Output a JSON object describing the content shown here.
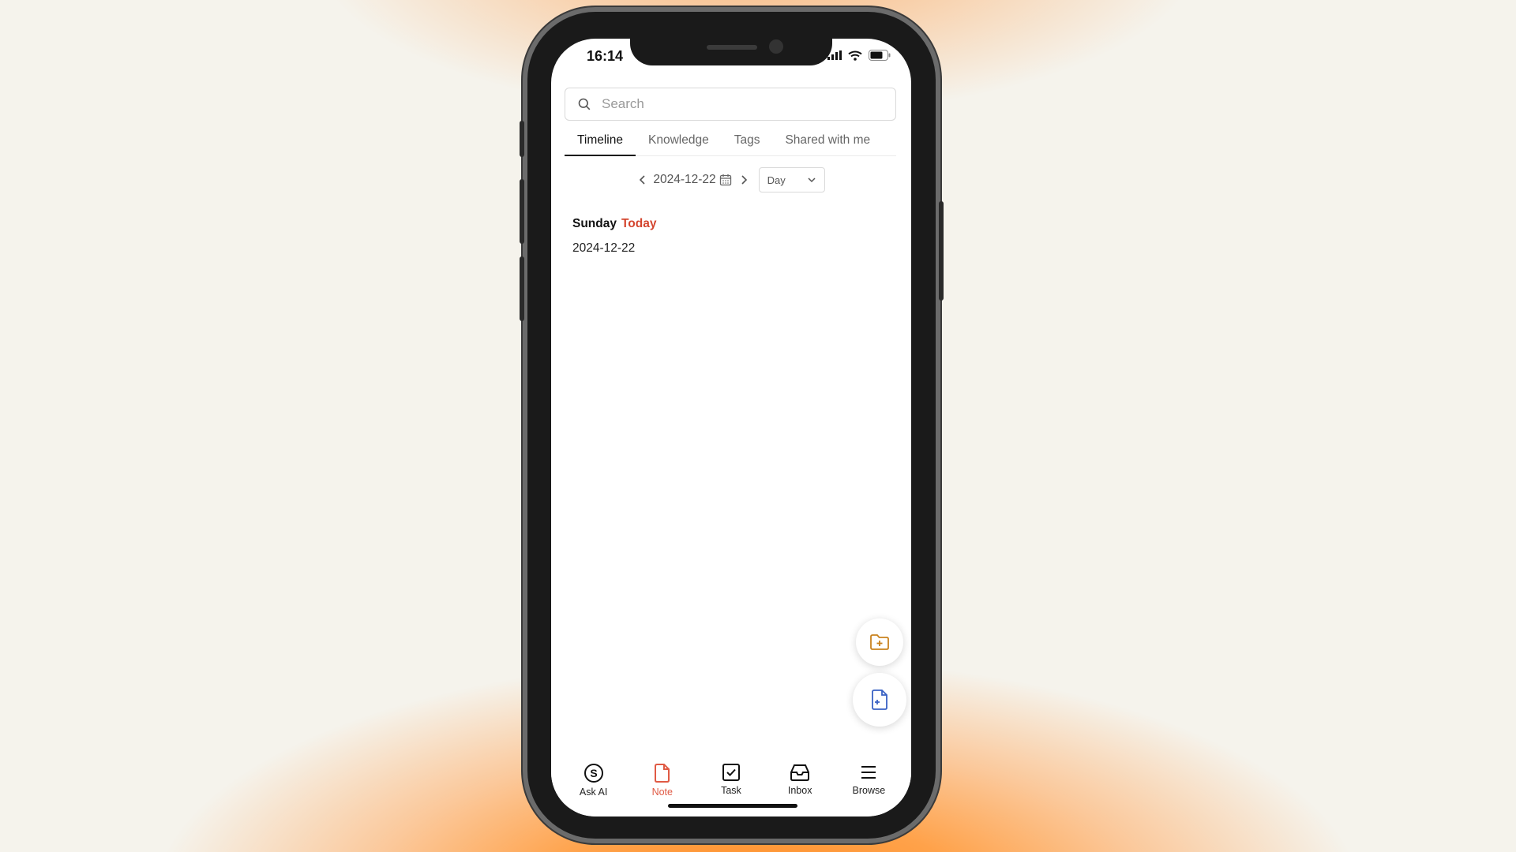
{
  "status_bar": {
    "time": "16:14"
  },
  "search": {
    "placeholder": "Search"
  },
  "tabs": [
    {
      "label": "Timeline",
      "active": true
    },
    {
      "label": "Knowledge",
      "active": false
    },
    {
      "label": "Tags",
      "active": false
    },
    {
      "label": "Shared with me",
      "active": false
    }
  ],
  "date_nav": {
    "date": "2024-12-22",
    "view_select": "Day"
  },
  "day": {
    "weekday": "Sunday",
    "today_label": "Today",
    "date": "2024-12-22"
  },
  "bottom_nav": [
    {
      "label": "Ask AI",
      "icon": "ask-ai-icon"
    },
    {
      "label": "Note",
      "icon": "note-icon",
      "active": true
    },
    {
      "label": "Task",
      "icon": "task-icon"
    },
    {
      "label": "Inbox",
      "icon": "inbox-icon"
    },
    {
      "label": "Browse",
      "icon": "browse-icon"
    }
  ],
  "colors": {
    "accent": "#d4452e",
    "folder_fab": "#c9821f",
    "note_fab": "#3a62c4"
  }
}
